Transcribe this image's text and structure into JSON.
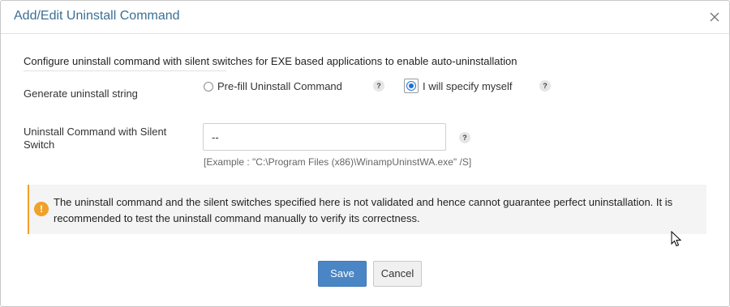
{
  "dialog": {
    "title": "Add/Edit Uninstall Command",
    "close_icon": "close-icon"
  },
  "section": {
    "heading": "Configure uninstall command with silent switches for EXE based applications to enable auto-uninstallation"
  },
  "generate": {
    "label": "Generate uninstall string",
    "options": [
      {
        "label": "Pre-fill Uninstall Command",
        "selected": false
      },
      {
        "label": "I will specify myself",
        "selected": true
      }
    ],
    "help_text": "?"
  },
  "command": {
    "label_line1": "Uninstall Command with Silent",
    "label_line2": "Switch",
    "value": "--",
    "example": "[Example : \"C:\\Program Files (x86)\\WinampUninstWA.exe\" /S]",
    "help_text": "?"
  },
  "alert": {
    "icon_text": "!",
    "message": "The uninstall command and the silent switches specified here is not validated and hence cannot guarantee perfect uninstallation. It is recommended to test the uninstall command manually to verify its correctness.",
    "accent_color": "#f0a12a"
  },
  "buttons": {
    "save": "Save",
    "cancel": "Cancel",
    "save_color": "#4a86c5"
  },
  "colors": {
    "title": "#3c6f94",
    "radio_selected": "#1b74d6"
  }
}
